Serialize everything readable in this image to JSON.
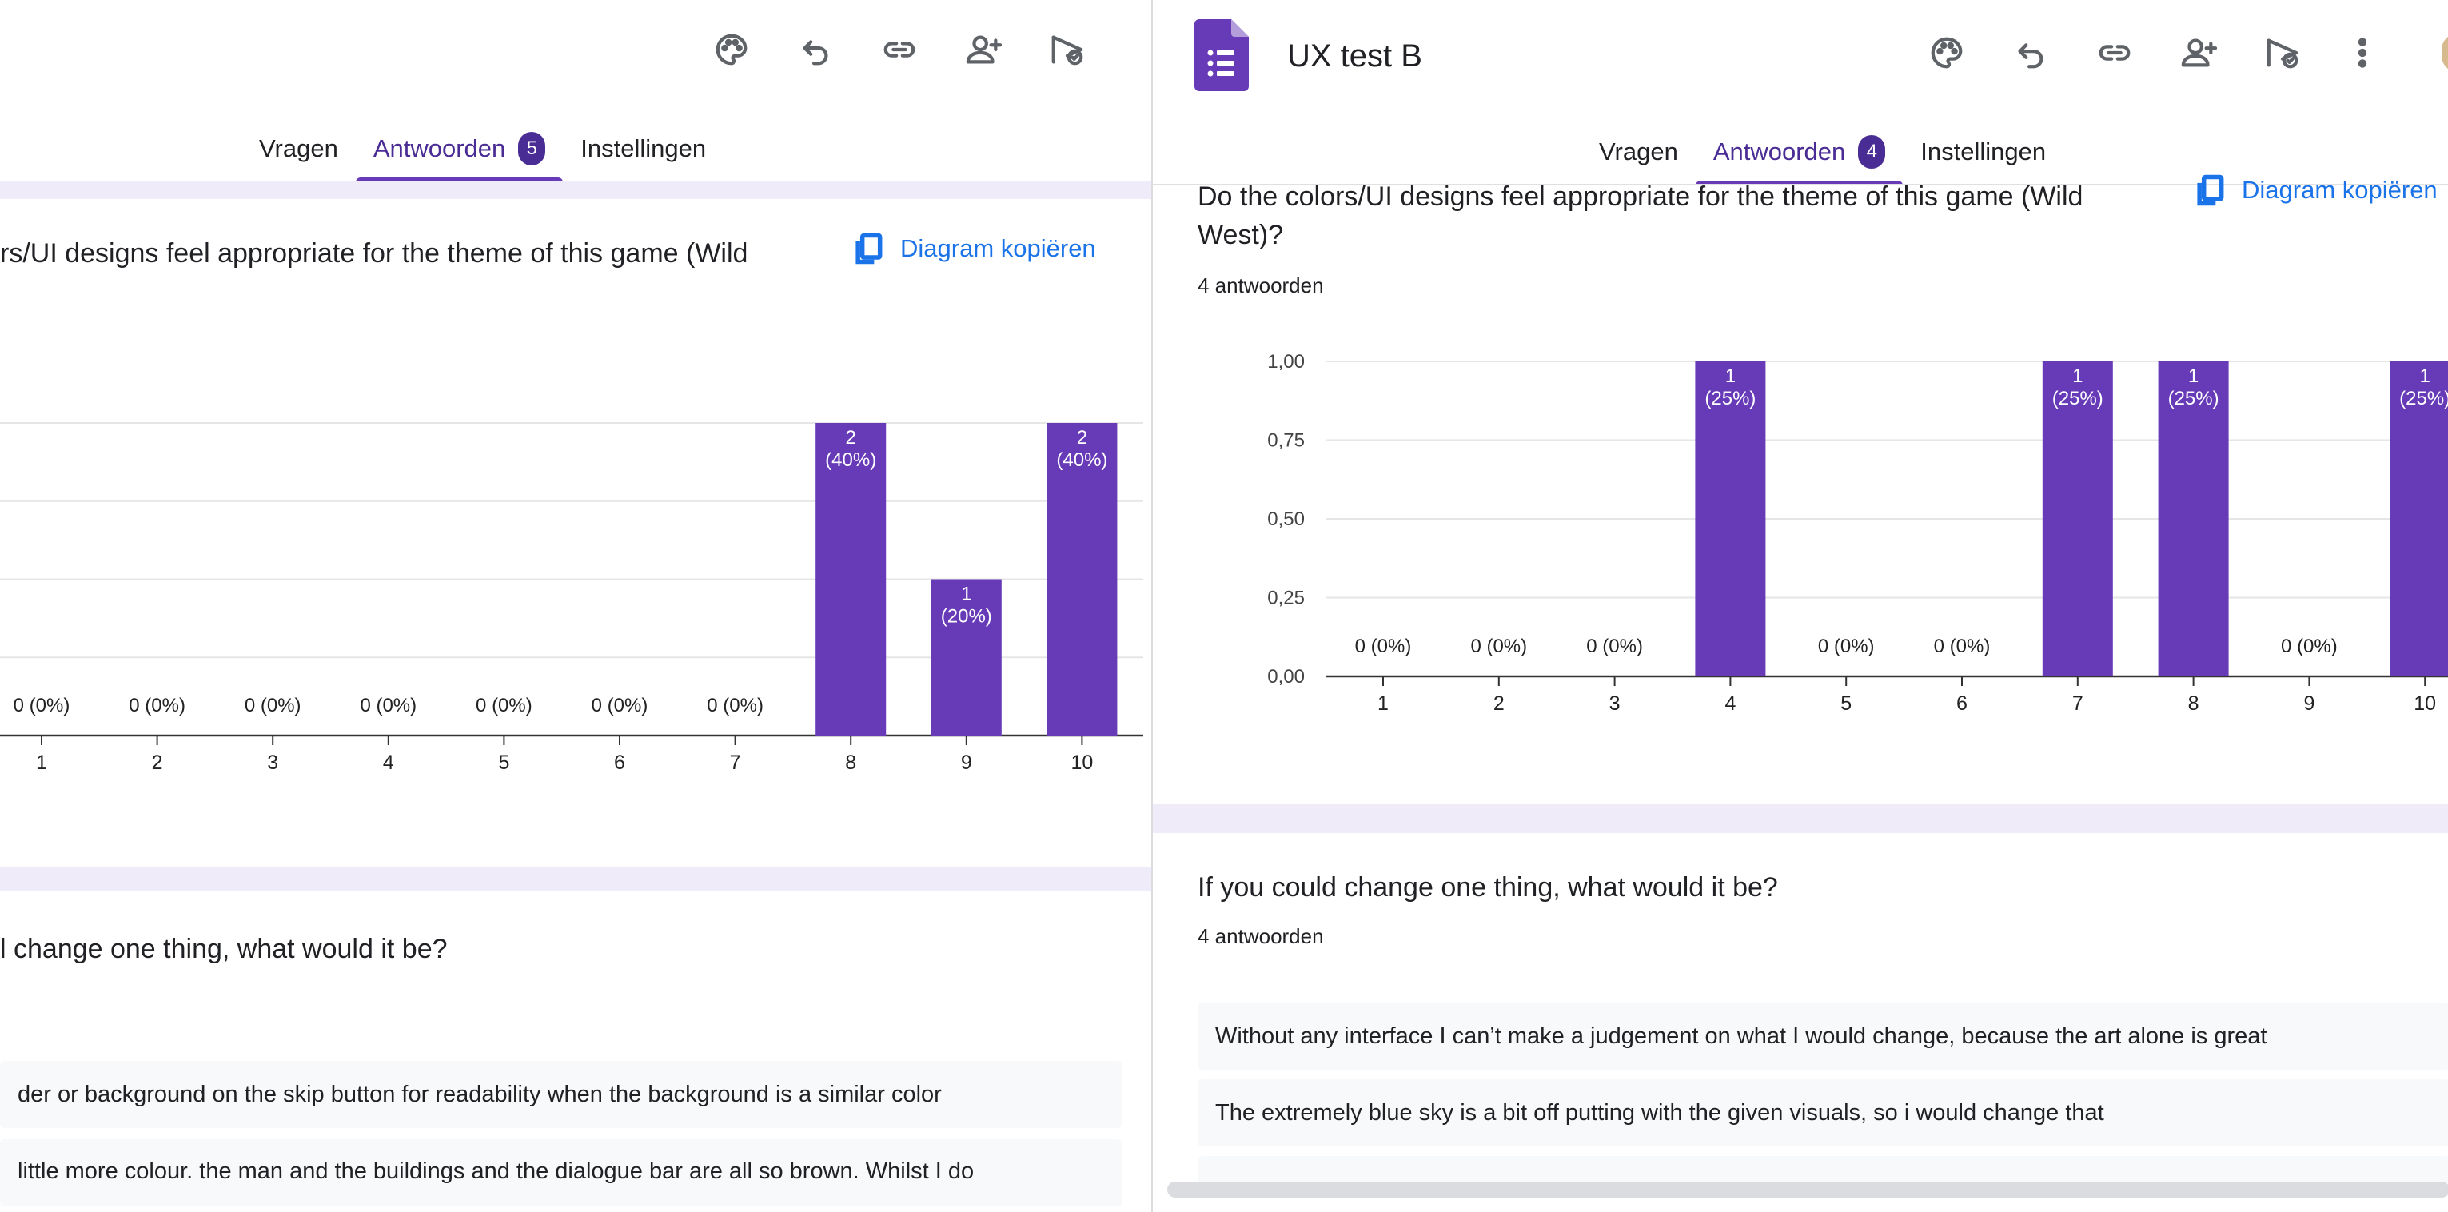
{
  "window_a": {
    "tabs": [
      {
        "label": "Vragen"
      },
      {
        "label": "Antwoorden",
        "badge": "5",
        "active": true
      },
      {
        "label": "Instellingen"
      }
    ],
    "chart_question": {
      "title": "rs/UI designs feel appropriate for the theme of this game (Wild",
      "copy_label": "Diagram kopiëren"
    },
    "chart_data": {
      "type": "bar",
      "categories": [
        "1",
        "2",
        "3",
        "4",
        "5",
        "6",
        "7",
        "8",
        "9",
        "10"
      ],
      "values": [
        0,
        0,
        0,
        0,
        0,
        0,
        0,
        2,
        1,
        2
      ],
      "labels": [
        "0 (0%)",
        "0 (0%)",
        "0 (0%)",
        "0 (0%)",
        "0 (0%)",
        "0 (0%)",
        "0 (0%)",
        "2\n(40%)",
        "1\n(20%)",
        "2\n(40%)"
      ],
      "ylim": [
        0,
        2
      ],
      "bar_color": "#673ab7"
    },
    "text_question": {
      "title": "l change one thing, what would it be?",
      "answers": [
        "der or background on the skip button for readability when the background is a similar color",
        "little more colour. the man and the buildings and the dialogue bar are all so brown. Whilst I do"
      ]
    }
  },
  "window_b": {
    "form_title": "UX test B",
    "tabs": [
      {
        "label": "Vragen"
      },
      {
        "label": "Antwoorden",
        "badge": "4",
        "active": true
      },
      {
        "label": "Instellingen"
      }
    ],
    "chart_question": {
      "title_line1": "Do the colors/UI designs feel appropriate for the theme of this game (Wild",
      "title_line2": "West)?",
      "count": "4 antwoorden",
      "copy_label": "Diagram kopiëren"
    },
    "chart_data": {
      "type": "bar",
      "categories": [
        "1",
        "2",
        "3",
        "4",
        "5",
        "6",
        "7",
        "8",
        "9",
        "10"
      ],
      "values": [
        0,
        0,
        0,
        1,
        0,
        0,
        1,
        1,
        0,
        1
      ],
      "labels": [
        "0 (0%)",
        "0 (0%)",
        "0 (0%)",
        "1\n(25%)",
        "0 (0%)",
        "0 (0%)",
        "1\n(25%)",
        "1\n(25%)",
        "0 (0%)",
        "1\n(25%)"
      ],
      "yticks": [
        "0,00",
        "0,25",
        "0,50",
        "0,75",
        "1,00"
      ],
      "ylim": [
        0,
        1
      ],
      "bar_color": "#673ab7"
    },
    "text_question": {
      "title": "If you could change one thing, what would it be?",
      "count": "4 antwoorden",
      "answers": [
        "Without any interface I can’t make a judgement on what I would change, because the art alone is great",
        "The extremely blue sky is a bit off putting with the given visuals, so i would change that"
      ]
    }
  },
  "colors": {
    "accent": "#673ab7",
    "link": "#1a73e8",
    "band": "#f0ebf8"
  }
}
